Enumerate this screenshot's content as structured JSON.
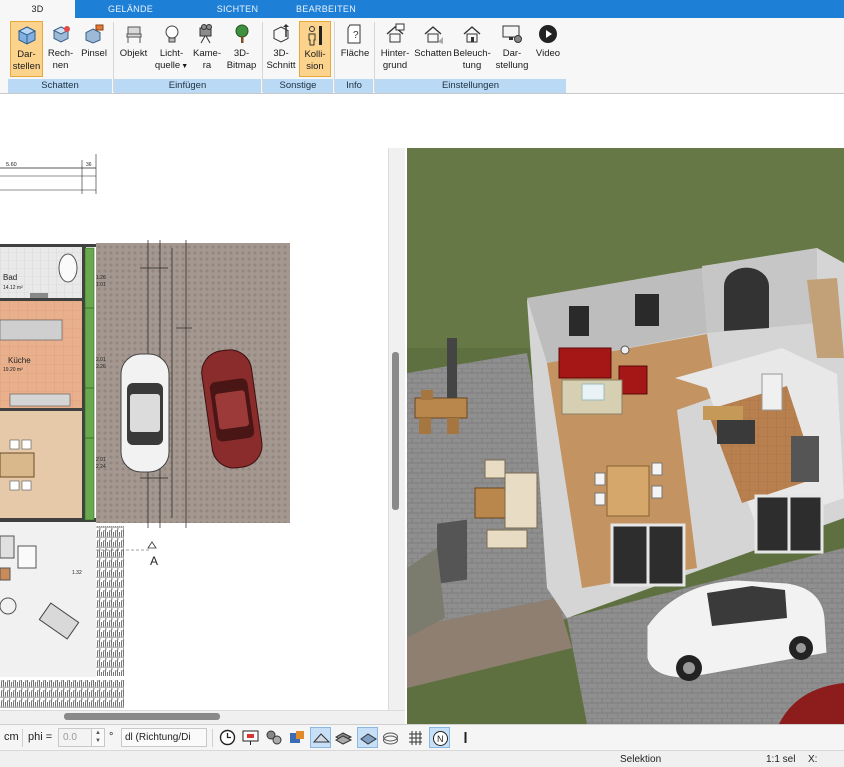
{
  "tabs": [
    {
      "label": "3D",
      "active": true
    },
    {
      "label": "GELÄNDE",
      "active": false
    },
    {
      "label": "SICHTEN",
      "active": false
    },
    {
      "label": "BEARBEITEN",
      "active": false
    }
  ],
  "ribbon": {
    "buttons": [
      {
        "line1": "Dar-",
        "line2": "stellen",
        "icon": "cube-render-icon",
        "selected": true
      },
      {
        "line1": "Rech-",
        "line2": "nen",
        "icon": "cube-compute-icon",
        "selected": false
      },
      {
        "line1": "Pinsel",
        "line2": "",
        "icon": "paint-cube-icon",
        "selected": false
      },
      {
        "line1": "Objekt",
        "line2": "",
        "icon": "chair-icon",
        "selected": false
      },
      {
        "line1": "Licht-",
        "line2": "quelle",
        "icon": "light-bulb-icon",
        "selected": false
      },
      {
        "line1": "Kame-",
        "line2": "ra",
        "icon": "camera-icon",
        "selected": false
      },
      {
        "line1": "3D-",
        "line2": "Bitmap",
        "icon": "tree-icon",
        "selected": false
      },
      {
        "line1": "3D-",
        "line2": "Schnitt",
        "icon": "section-cube-icon",
        "selected": false
      },
      {
        "line1": "Kolli-",
        "line2": "sion",
        "icon": "collision-person-icon",
        "selected": true
      },
      {
        "line1": "Fläche",
        "line2": "",
        "icon": "area-info-icon",
        "selected": false
      },
      {
        "line1": "Hinter-",
        "line2": "grund",
        "icon": "house-background-icon",
        "selected": false
      },
      {
        "line1": "Schatten",
        "line2": "",
        "icon": "house-shadow-icon",
        "selected": false
      },
      {
        "line1": "Beleuch-",
        "line2": "tung",
        "icon": "house-light-icon",
        "selected": false
      },
      {
        "line1": "Dar-",
        "line2": "stellung",
        "icon": "monitor-settings-icon",
        "selected": false
      },
      {
        "line1": "Video",
        "line2": "",
        "icon": "play-icon",
        "selected": false
      }
    ],
    "groups": [
      "Schatten",
      "Einfügen",
      "Sonstige",
      "Info",
      "Einstellungen"
    ]
  },
  "plan": {
    "dimension_top": "5.60",
    "dimension_small": "36",
    "room_bad_name": "Bad",
    "room_bad_area": "14.12 m²",
    "room_kueche_name": "Küche",
    "room_kueche_area": "19.20 m²",
    "dim_a": "1.26",
    "dim_b": "1.01",
    "dim_c": "2.01",
    "dim_d": "2.26",
    "dim_e": "2.01",
    "dim_f": "2.24",
    "dim_g": "1.32",
    "section_marker": "A"
  },
  "bottom": {
    "unit": "cm",
    "phi_label": "phi =",
    "phi_value": "0.0",
    "degree": "°",
    "direction_select": "dl (Richtung/Di"
  },
  "status": {
    "mode": "Selektion",
    "scale": "1:1 sel",
    "x_label": "X:"
  }
}
